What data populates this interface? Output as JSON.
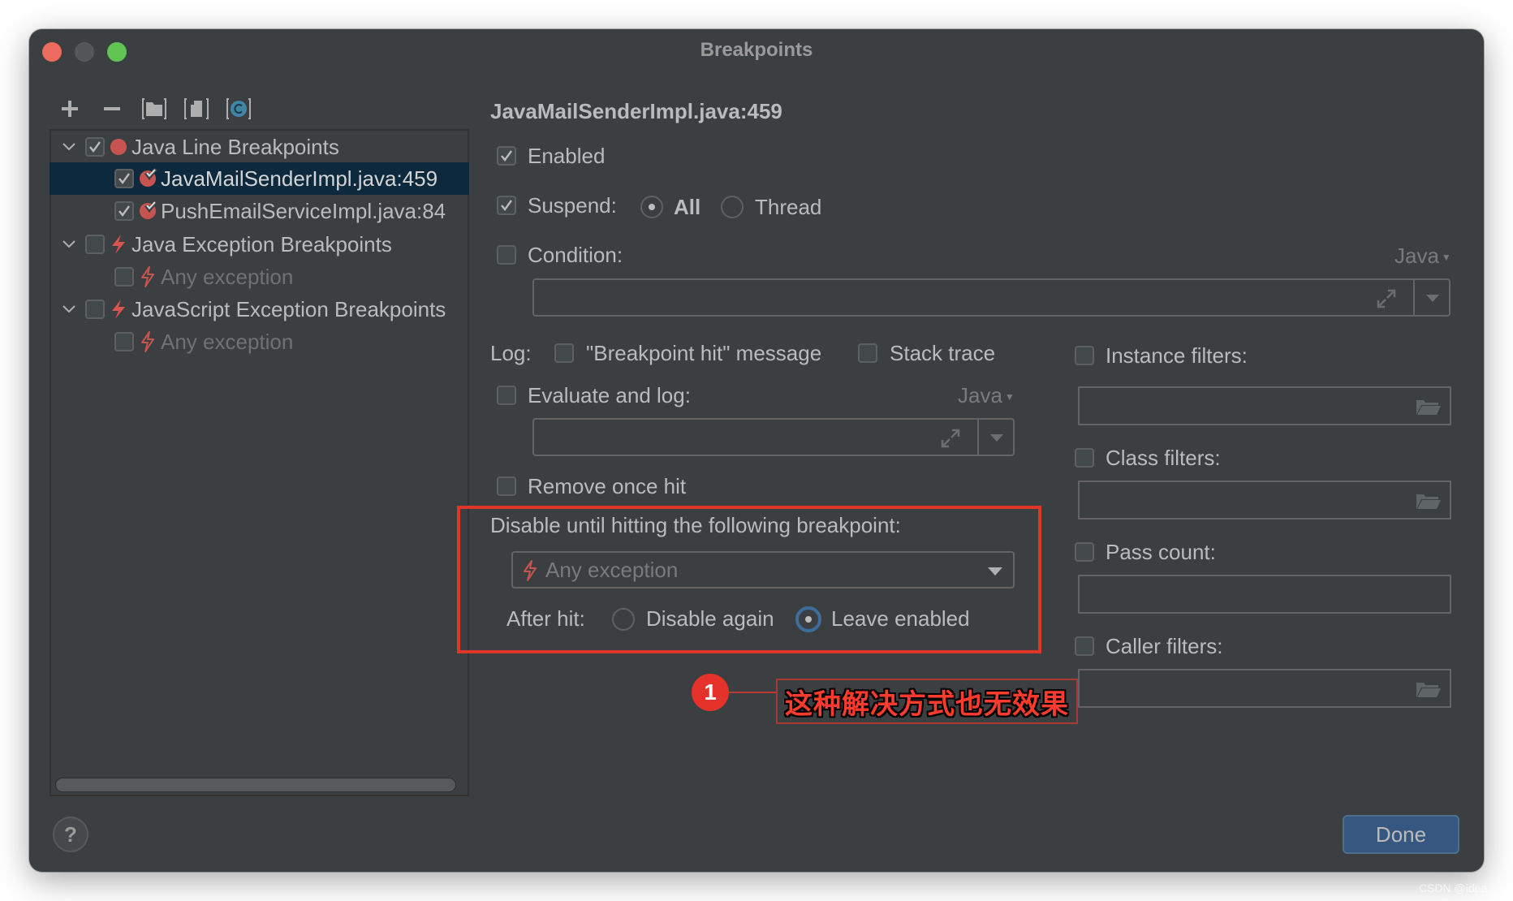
{
  "window": {
    "title": "Breakpoints",
    "traffic_lights": {
      "close": "#ed6a5e",
      "minimize": "#54575a",
      "zoom": "#61c554"
    }
  },
  "toolbar": {
    "buttons": [
      {
        "name": "add",
        "icon": "plus-icon",
        "glyph": "+"
      },
      {
        "name": "remove",
        "icon": "minus-icon",
        "glyph": "−"
      },
      {
        "name": "group-by-package",
        "icon": "folder-bracket-icon"
      },
      {
        "name": "group-by-file",
        "icon": "file-bracket-icon"
      },
      {
        "name": "group-by-class",
        "icon": "class-bracket-icon",
        "glyph": "C"
      }
    ]
  },
  "tree": {
    "items": [
      {
        "label": "Java Line Breakpoints",
        "level": 0,
        "expanded": true,
        "checked": true,
        "icon": "breakpoint-dot-icon",
        "dim": false,
        "selected": false
      },
      {
        "label": "JavaMailSenderImpl.java:459",
        "level": 1,
        "checked": true,
        "icon": "breakpoint-check-icon",
        "dim": false,
        "selected": true
      },
      {
        "label": "PushEmailServiceImpl.java:84",
        "level": 1,
        "checked": true,
        "icon": "breakpoint-check-icon",
        "dim": false,
        "selected": false
      },
      {
        "label": "Java Exception Breakpoints",
        "level": 0,
        "expanded": true,
        "checked": false,
        "icon": "lightning-icon",
        "dim": false,
        "selected": false
      },
      {
        "label": "Any exception",
        "level": 1,
        "checked": false,
        "icon": "lightning-outline-icon",
        "dim": true,
        "selected": false
      },
      {
        "label": "JavaScript Exception Breakpoints",
        "level": 0,
        "expanded": true,
        "checked": false,
        "icon": "lightning-icon",
        "dim": false,
        "selected": false
      },
      {
        "label": "Any exception",
        "level": 1,
        "checked": false,
        "icon": "lightning-outline-icon",
        "dim": true,
        "selected": false
      }
    ]
  },
  "details": {
    "heading": "JavaMailSenderImpl.java:459",
    "enabled": {
      "label": "Enabled",
      "checked": true
    },
    "suspend": {
      "label": "Suspend:",
      "checked": true,
      "options": [
        "All",
        "Thread"
      ],
      "selected": "All"
    },
    "condition": {
      "label": "Condition:",
      "checked": false,
      "language": "Java",
      "value": ""
    },
    "log": {
      "label": "Log:",
      "breakpoint_hit": {
        "label": "\"Breakpoint hit\" message",
        "checked": false
      },
      "stack_trace": {
        "label": "Stack trace",
        "checked": false
      }
    },
    "evaluate_and_log": {
      "label": "Evaluate and log:",
      "checked": false,
      "language": "Java",
      "value": ""
    },
    "remove_once_hit": {
      "label": "Remove once hit",
      "checked": false
    },
    "disable_until": {
      "label": "Disable until hitting the following breakpoint:",
      "selected": "Any exception",
      "after_hit_label": "After hit:",
      "after_hit_options": [
        "Disable again",
        "Leave enabled"
      ],
      "after_hit_selected": "Leave enabled"
    },
    "filters": {
      "instance": {
        "label": "Instance filters:",
        "checked": false,
        "value": ""
      },
      "class": {
        "label": "Class filters:",
        "checked": false,
        "value": ""
      },
      "pass_count": {
        "label": "Pass count:",
        "checked": false,
        "value": ""
      },
      "caller": {
        "label": "Caller filters:",
        "checked": false,
        "value": ""
      }
    }
  },
  "footer": {
    "help_label": "?",
    "done_label": "Done"
  },
  "annotation": {
    "number": "1",
    "text": "这种解决方式也无效果",
    "color": "#e5322a"
  },
  "watermark": "CSDN @idea"
}
